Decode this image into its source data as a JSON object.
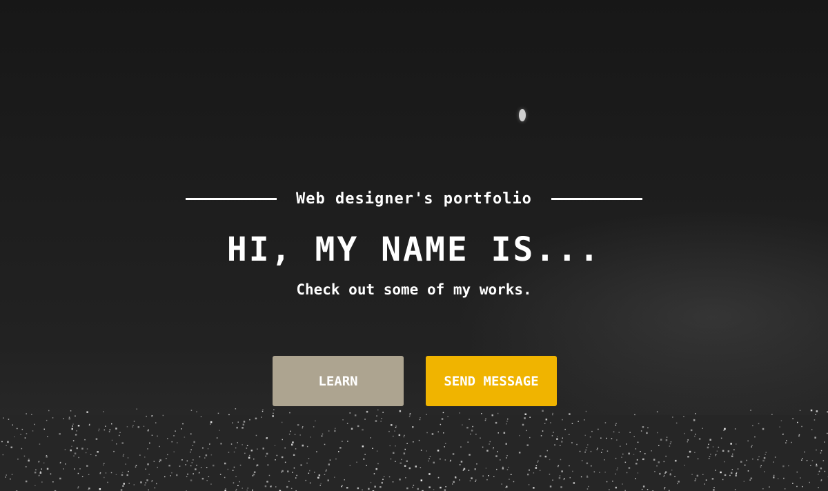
{
  "hero": {
    "kicker": "Web designer's portfolio",
    "headline": "HI, MY NAME IS...",
    "subline": "Check out some of my works."
  },
  "buttons": {
    "learn_label": "LEARN",
    "send_label": "SEND MESSAGE"
  },
  "colors": {
    "learn_button": "#ada490",
    "send_button": "#f0b400",
    "background": "#1c1c1c",
    "text": "#ffffff"
  }
}
